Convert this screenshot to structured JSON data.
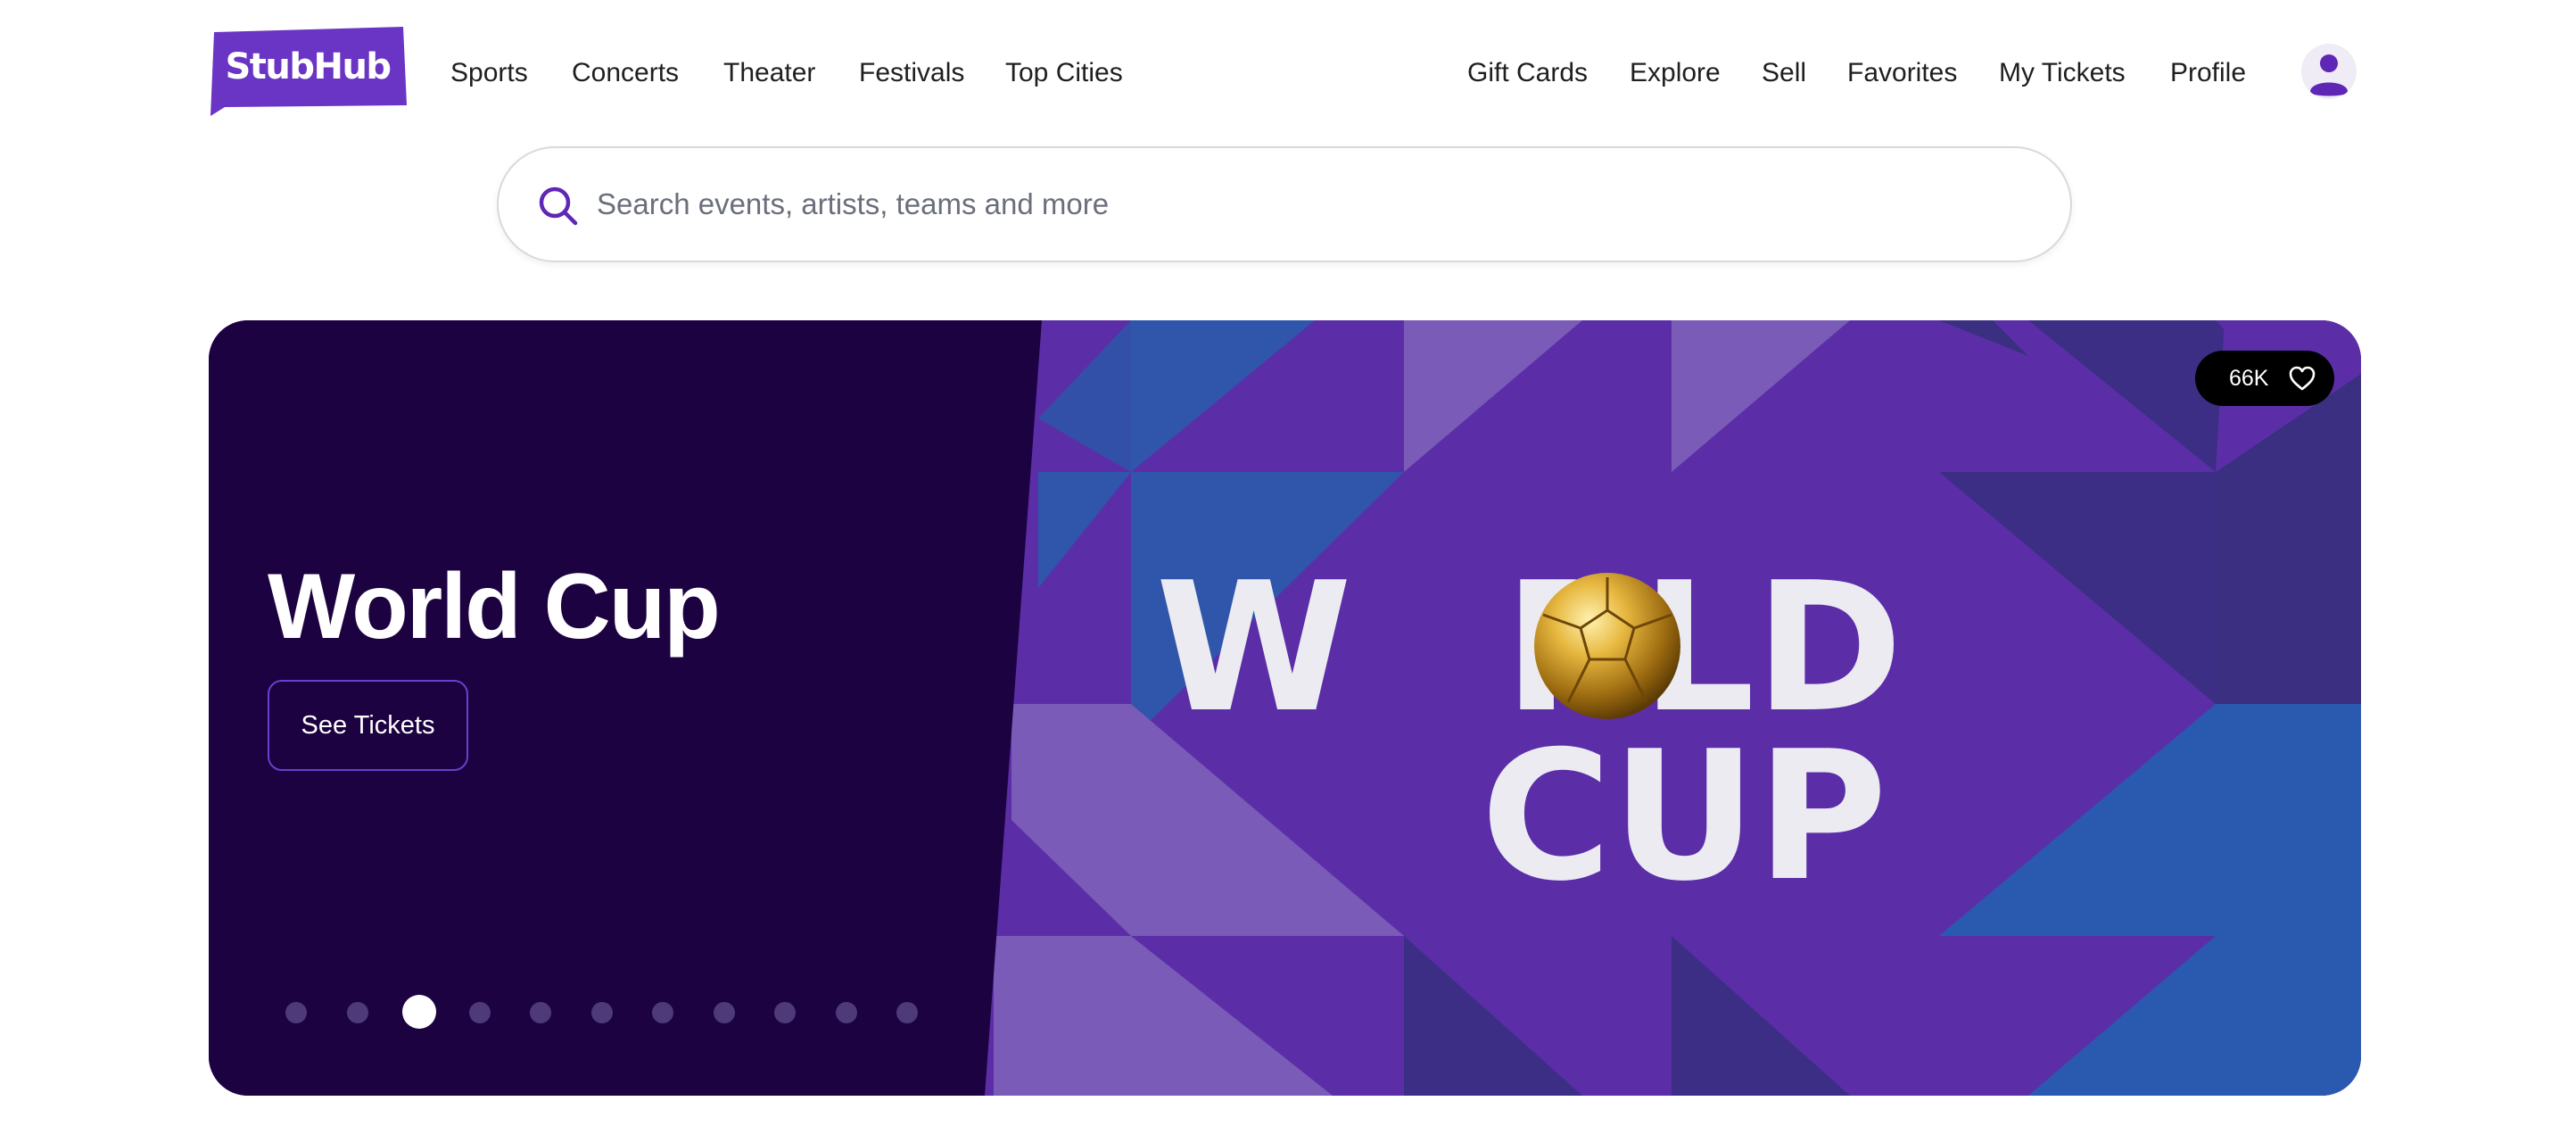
{
  "brand": {
    "logo_text": "StubHub",
    "color": "#6a34c4"
  },
  "nav_left": [
    "Sports",
    "Concerts",
    "Theater",
    "Festivals",
    "Top Cities"
  ],
  "nav_right": [
    "Gift Cards",
    "Explore",
    "Sell",
    "Favorites",
    "My Tickets",
    "Profile"
  ],
  "search": {
    "placeholder": "Search events, artists, teams and more",
    "value": "",
    "icon": "search-icon"
  },
  "hero": {
    "title": "World Cup",
    "cta_label": "See Tickets",
    "likes": "66K",
    "artwork_line1_left": "W",
    "artwork_line1_right": "RLD",
    "artwork_line2": "CUP",
    "slide_count": 11,
    "active_slide": 3,
    "colors": {
      "panel": "#1c0240",
      "artwork": "#5b2ea8",
      "accent_blue": "#2a5ab0"
    }
  },
  "user": {
    "avatar_icon": "user-avatar-icon"
  }
}
